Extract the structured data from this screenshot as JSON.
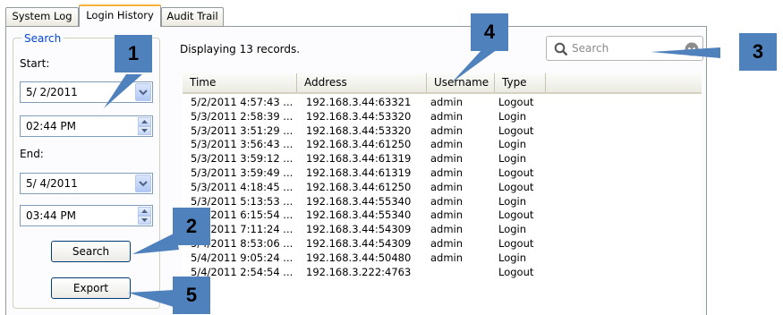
{
  "tabs": [
    {
      "label": "System Log"
    },
    {
      "label": "Login History"
    },
    {
      "label": "Audit Trail"
    }
  ],
  "active_tab": "Login History",
  "search_panel": {
    "title": "Search",
    "start_label": "Start:",
    "start_date": "5/ 2/2011",
    "start_time": "02:44 PM",
    "end_label": "End:",
    "end_date": "5/ 4/2011",
    "end_time": "03:44 PM",
    "search_button": "Search",
    "export_button": "Export"
  },
  "records_text": "Displaying 13 records.",
  "search_box": {
    "placeholder": "Search"
  },
  "table": {
    "columns": [
      "Time",
      "Address",
      "Username",
      "Type"
    ],
    "rows": [
      [
        "5/2/2011 4:57:43 ...",
        "192.168.3.44:63321",
        "admin",
        "Logout"
      ],
      [
        "5/3/2011 2:58:39 ...",
        "192.168.3.44:53320",
        "admin",
        "Login"
      ],
      [
        "5/3/2011 3:51:29 ...",
        "192.168.3.44:53320",
        "admin",
        "Logout"
      ],
      [
        "5/3/2011 3:56:43 ...",
        "192.168.3.44:61250",
        "admin",
        "Login"
      ],
      [
        "5/3/2011 3:59:12 ...",
        "192.168.3.44:61319",
        "admin",
        "Login"
      ],
      [
        "5/3/2011 3:59:49 ...",
        "192.168.3.44:61319",
        "admin",
        "Logout"
      ],
      [
        "5/3/2011 4:18:45 ...",
        "192.168.3.44:61250",
        "admin",
        "Logout"
      ],
      [
        "5/3/2011 5:13:53 ...",
        "192.168.3.44:55340",
        "admin",
        "Login"
      ],
      [
        "5/3/2011 6:15:54 ...",
        "192.168.3.44:55340",
        "admin",
        "Logout"
      ],
      [
        "5/4/2011 7:11:24 ...",
        "192.168.3.44:54309",
        "admin",
        "Login"
      ],
      [
        "5/4/2011 8:53:06 ...",
        "192.168.3.44:54309",
        "admin",
        "Logout"
      ],
      [
        "5/4/2011 9:05:24 ...",
        "192.168.3.44:50480",
        "admin",
        "Login"
      ],
      [
        "5/4/2011 2:54:54 ...",
        "192.168.3.222:4763",
        "",
        "Logout"
      ]
    ]
  },
  "callouts": [
    "1",
    "2",
    "3",
    "4",
    "5"
  ],
  "colors": {
    "callout": "#4f81bd",
    "active_tab_accent": "#f7b335",
    "group_title": "#0046d5"
  }
}
